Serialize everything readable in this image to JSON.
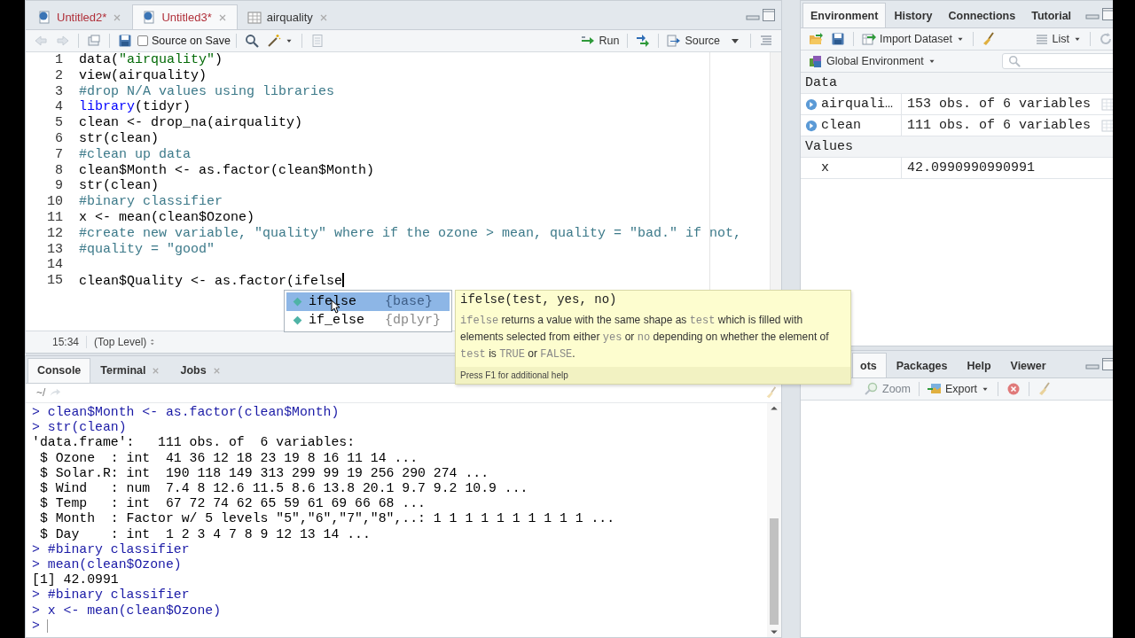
{
  "editor": {
    "tabs": [
      {
        "label": "Untitled2*",
        "kind": "script",
        "modified": true,
        "selected": false
      },
      {
        "label": "Untitled3*",
        "kind": "script",
        "modified": true,
        "selected": true
      },
      {
        "label": "airquality",
        "kind": "data",
        "modified": false,
        "selected": false
      }
    ],
    "toolbar": {
      "source_on_save": {
        "label": "Source on Save",
        "checked": false
      },
      "run": "Run",
      "source": "Source"
    },
    "lines": [
      {
        "number": "1",
        "tokens": [
          {
            "kind": "plain",
            "text": "data("
          },
          {
            "kind": "string",
            "text": "\"airquality\""
          },
          {
            "kind": "plain",
            "text": ")"
          }
        ]
      },
      {
        "number": "2",
        "tokens": [
          {
            "kind": "plain",
            "text": "view(airquality)"
          }
        ]
      },
      {
        "number": "3",
        "tokens": [
          {
            "kind": "comment",
            "text": "#drop N/A values using libraries"
          }
        ]
      },
      {
        "number": "4",
        "tokens": [
          {
            "kind": "keyword",
            "text": "library"
          },
          {
            "kind": "plain",
            "text": "(tidyr)"
          }
        ]
      },
      {
        "number": "5",
        "tokens": [
          {
            "kind": "plain",
            "text": "clean <- drop_na(airquality)"
          }
        ]
      },
      {
        "number": "6",
        "tokens": [
          {
            "kind": "plain",
            "text": "str(clean)"
          }
        ]
      },
      {
        "number": "7",
        "tokens": [
          {
            "kind": "comment",
            "text": "#clean up data"
          }
        ]
      },
      {
        "number": "8",
        "tokens": [
          {
            "kind": "plain",
            "text": "clean$Month <- as.factor(clean$Month)"
          }
        ]
      },
      {
        "number": "9",
        "tokens": [
          {
            "kind": "plain",
            "text": "str(clean)"
          }
        ]
      },
      {
        "number": "10",
        "tokens": [
          {
            "kind": "comment",
            "text": "#binary classifier"
          }
        ]
      },
      {
        "number": "11",
        "tokens": [
          {
            "kind": "plain",
            "text": "x <- mean(clean$Ozone)"
          }
        ]
      },
      {
        "number": "12",
        "tokens": [
          {
            "kind": "comment",
            "text": "#create new variable, \"quality\" where if the ozone > mean, quality = \"bad.\" if not,"
          }
        ]
      },
      {
        "number": "13",
        "tokens": [
          {
            "kind": "comment",
            "text": "#quality = \"good\""
          }
        ]
      },
      {
        "number": "14"
      },
      {
        "number": "15",
        "cursor": true,
        "tokens": [
          {
            "kind": "plain",
            "text": "clean$Quality <- as.factor(ifelse"
          }
        ]
      }
    ],
    "status": {
      "position": "15:34",
      "scope": "(Top Level)"
    }
  },
  "autocomplete": {
    "items": [
      {
        "name": "ifelse",
        "package": "{base}",
        "selected": true
      },
      {
        "name": "if_else",
        "package": "{dplyr}",
        "selected": false
      }
    ]
  },
  "tooltip": {
    "signature": "ifelse(test, yes, no)",
    "description": [
      {
        "kind": "code",
        "text": "ifelse"
      },
      {
        "kind": "text",
        "text": " returns a value with the same shape as "
      },
      {
        "kind": "code",
        "text": "test"
      },
      {
        "kind": "text",
        "text": " which is filled with elements selected from either "
      },
      {
        "kind": "code",
        "text": "yes"
      },
      {
        "kind": "text",
        "text": " or "
      },
      {
        "kind": "code",
        "text": "no"
      },
      {
        "kind": "text",
        "text": " depending on whether the element of "
      },
      {
        "kind": "code",
        "text": "test"
      },
      {
        "kind": "text",
        "text": " is "
      },
      {
        "kind": "code",
        "text": "TRUE"
      },
      {
        "kind": "text",
        "text": " or "
      },
      {
        "kind": "code",
        "text": "FALSE"
      },
      {
        "kind": "text",
        "text": "."
      }
    ],
    "footer": "Press F1 for additional help"
  },
  "console": {
    "tabs": [
      {
        "label": "Console",
        "closable": false,
        "selected": true
      },
      {
        "label": "Terminal",
        "closable": true,
        "selected": false
      },
      {
        "label": "Jobs",
        "closable": true,
        "selected": false
      }
    ],
    "path": "~/",
    "lines": [
      {
        "kind": "input",
        "text": "> clean$Month <- as.factor(clean$Month)"
      },
      {
        "kind": "input",
        "text": "> str(clean)"
      },
      {
        "kind": "output",
        "text": "'data.frame':   111 obs. of  6 variables:"
      },
      {
        "kind": "output",
        "text": " $ Ozone  : int  41 36 12 18 23 19 8 16 11 14 ..."
      },
      {
        "kind": "output",
        "text": " $ Solar.R: int  190 118 149 313 299 99 19 256 290 274 ..."
      },
      {
        "kind": "output",
        "text": " $ Wind   : num  7.4 8 12.6 11.5 8.6 13.8 20.1 9.7 9.2 10.9 ..."
      },
      {
        "kind": "output",
        "text": " $ Temp   : int  67 72 74 62 65 59 61 69 66 68 ..."
      },
      {
        "kind": "output",
        "text": " $ Month  : Factor w/ 5 levels \"5\",\"6\",\"7\",\"8\",..: 1 1 1 1 1 1 1 1 1 1 ..."
      },
      {
        "kind": "output",
        "text": " $ Day    : int  1 2 3 4 7 8 9 12 13 14 ..."
      },
      {
        "kind": "input",
        "text": "> #binary classifier"
      },
      {
        "kind": "input",
        "text": "> mean(clean$Ozone)"
      },
      {
        "kind": "output",
        "text": "[1] 42.0991"
      },
      {
        "kind": "input",
        "text": "> #binary classifier"
      },
      {
        "kind": "input",
        "text": "> x <- mean(clean$Ozone)"
      },
      {
        "kind": "prompt",
        "text": ">"
      }
    ]
  },
  "environment": {
    "tabs": [
      {
        "label": "Environment",
        "selected": true
      },
      {
        "label": "History",
        "selected": false
      },
      {
        "label": "Connections",
        "selected": false
      },
      {
        "label": "Tutorial",
        "selected": false
      }
    ],
    "toolbar": {
      "import": "Import Dataset",
      "view": "List"
    },
    "scope": "Global Environment",
    "sections": [
      {
        "title": "Data",
        "rows": [
          {
            "kind": "data",
            "name": "airquali…",
            "value": "153 obs. of 6 variables"
          },
          {
            "kind": "data",
            "name": "clean",
            "value": "111 obs. of 6 variables"
          }
        ]
      },
      {
        "title": "Values",
        "rows": [
          {
            "kind": "value",
            "name": "x",
            "value": "42.0990990990991"
          }
        ]
      }
    ]
  },
  "plots": {
    "tabs": [
      {
        "label": "ots",
        "selected": true
      },
      {
        "label": "Packages",
        "selected": false
      },
      {
        "label": "Help",
        "selected": false
      },
      {
        "label": "Viewer",
        "selected": false
      }
    ],
    "toolbar": {
      "zoom": {
        "label": "Zoom",
        "disabled": true
      },
      "export": {
        "label": "Export",
        "disabled": false
      }
    }
  }
}
